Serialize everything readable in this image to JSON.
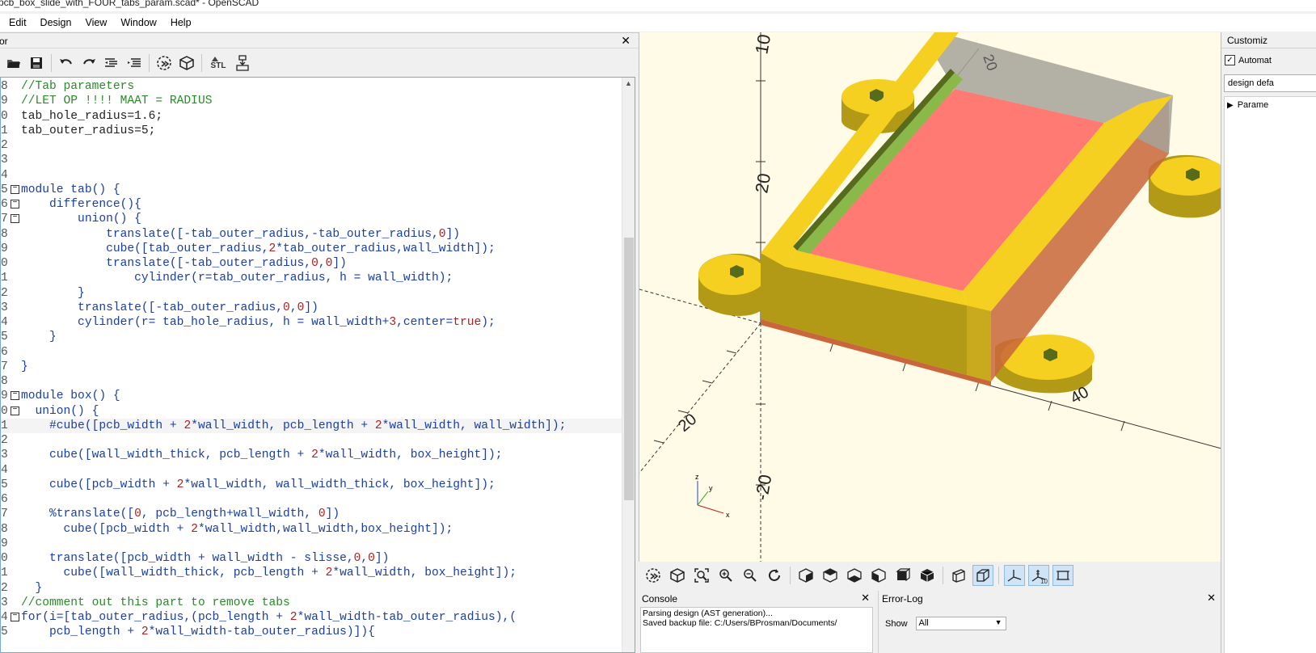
{
  "window": {
    "title": "pcb_box_slide_with_FOUR_tabs_param.scad* - OpenSCAD"
  },
  "menu": [
    "Edit",
    "Design",
    "View",
    "Window",
    "Help"
  ],
  "editor": {
    "panel_title": "or",
    "toolbar_icons": [
      "open-icon",
      "save-icon",
      "undo-icon",
      "redo-icon",
      "unindent-icon",
      "indent-icon",
      "preview-icon",
      "render-icon",
      "export-stl-icon",
      "send-to-print-icon"
    ],
    "toolbar_labels": {
      "stl": "STL"
    },
    "lines": [
      {
        "n": "8",
        "text": "//Tab parameters",
        "kind": "comment"
      },
      {
        "n": "9",
        "text": "//LET OP !!!! MAAT = RADIUS",
        "kind": "comment"
      },
      {
        "n": "0",
        "text": "tab_hole_radius=1.6;",
        "kind": "plain"
      },
      {
        "n": "1",
        "text": "tab_outer_radius=5;",
        "kind": "plain"
      },
      {
        "n": "2",
        "text": "",
        "kind": "plain"
      },
      {
        "n": "3",
        "text": "",
        "kind": "plain"
      },
      {
        "n": "4",
        "text": "",
        "kind": "plain"
      },
      {
        "n": "5",
        "text": "module tab() {",
        "kind": "kw",
        "fold": true
      },
      {
        "n": "6",
        "text": "    difference(){",
        "kind": "kw",
        "fold": true
      },
      {
        "n": "7",
        "text": "        union() {",
        "kind": "kw",
        "fold": true
      },
      {
        "n": "8",
        "text": "            translate([-tab_outer_radius,-tab_outer_radius,0])",
        "kind": "kw"
      },
      {
        "n": "9",
        "text": "            cube([tab_outer_radius,2*tab_outer_radius,wall_width]);",
        "kind": "kw"
      },
      {
        "n": "0",
        "text": "            translate([-tab_outer_radius,0,0])",
        "kind": "kw"
      },
      {
        "n": "1",
        "text": "                cylinder(r=tab_outer_radius, h = wall_width);",
        "kind": "kw"
      },
      {
        "n": "2",
        "text": "        }",
        "kind": "kw"
      },
      {
        "n": "3",
        "text": "        translate([-tab_outer_radius,0,0])",
        "kind": "kw"
      },
      {
        "n": "4",
        "text": "        cylinder(r= tab_hole_radius, h = wall_width+3,center=true);",
        "kind": "kw"
      },
      {
        "n": "5",
        "text": "    }",
        "kind": "kw"
      },
      {
        "n": "6",
        "text": "",
        "kind": "plain"
      },
      {
        "n": "7",
        "text": "}",
        "kind": "kw"
      },
      {
        "n": "8",
        "text": "",
        "kind": "plain"
      },
      {
        "n": "9",
        "text": "module box() {",
        "kind": "kw",
        "fold": true
      },
      {
        "n": "0",
        "text": "  union() {",
        "kind": "kw",
        "fold": true
      },
      {
        "n": "1",
        "text": "    #cube([pcb_width + 2*wall_width, pcb_length + 2*wall_width, wall_width]);",
        "kind": "kw",
        "hl": true
      },
      {
        "n": "2",
        "text": "",
        "kind": "plain"
      },
      {
        "n": "3",
        "text": "    cube([wall_width_thick, pcb_length + 2*wall_width, box_height]);",
        "kind": "kw"
      },
      {
        "n": "4",
        "text": "",
        "kind": "plain"
      },
      {
        "n": "5",
        "text": "    cube([pcb_width + 2*wall_width, wall_width_thick, box_height]);",
        "kind": "kw"
      },
      {
        "n": "6",
        "text": "",
        "kind": "plain"
      },
      {
        "n": "7",
        "text": "    %translate([0, pcb_length+wall_width, 0])",
        "kind": "kw"
      },
      {
        "n": "8",
        "text": "      cube([pcb_width + 2*wall_width,wall_width,box_height]);",
        "kind": "kw"
      },
      {
        "n": "9",
        "text": "",
        "kind": "plain"
      },
      {
        "n": "0",
        "text": "    translate([pcb_width + wall_width - slisse,0,0])",
        "kind": "kw"
      },
      {
        "n": "1",
        "text": "      cube([wall_width_thick, pcb_length + 2*wall_width, box_height]);",
        "kind": "kw"
      },
      {
        "n": "2",
        "text": "  }",
        "kind": "kw"
      },
      {
        "n": "3",
        "text": "//comment out this part to remove tabs",
        "kind": "comment"
      },
      {
        "n": "4",
        "text": "for(i=[tab_outer_radius,(pcb_length + 2*wall_width-tab_outer_radius),(",
        "kind": "kw",
        "fold": true
      },
      {
        "n": "5",
        "text": "    pcb_length + 2*wall_width-tab_outer_radius)]){",
        "kind": "kw"
      }
    ]
  },
  "viewport": {
    "axis_labels": [
      "10",
      "20",
      "20",
      "40",
      "20",
      "-20"
    ],
    "colors": {
      "background": "#fffbe6",
      "body": "#f5d020",
      "side": "#b29a16",
      "highlight": "#ff8080",
      "ghost": "#a8a8a8",
      "slot": "#8ab94a"
    },
    "gizmo": {
      "x": "x",
      "y": "y",
      "z": "z"
    }
  },
  "view_toolbar": {
    "icons": [
      "preview-icon",
      "render-icon",
      "view-all-icon",
      "zoom-in-icon",
      "zoom-out-icon",
      "reset-view-icon",
      "view-right-icon",
      "view-top-icon",
      "view-bottom-icon",
      "view-left-icon",
      "view-front-icon",
      "view-back-icon",
      "perspective-icon",
      "orthogonal-icon",
      "show-axes-icon",
      "show-scale-icon",
      "show-edges-icon"
    ],
    "scale_label": "10"
  },
  "console": {
    "title": "Console",
    "lines": [
      "Parsing design (AST generation)...",
      "Saved backup file: C:/Users/BProsman/Documents/"
    ]
  },
  "errorlog": {
    "title": "Error-Log",
    "show_label": "Show",
    "show_value": "All"
  },
  "customizer": {
    "title": "Customiz",
    "auto_label": "Automat",
    "preset_value": "design defa",
    "tree_item": "Parame"
  }
}
